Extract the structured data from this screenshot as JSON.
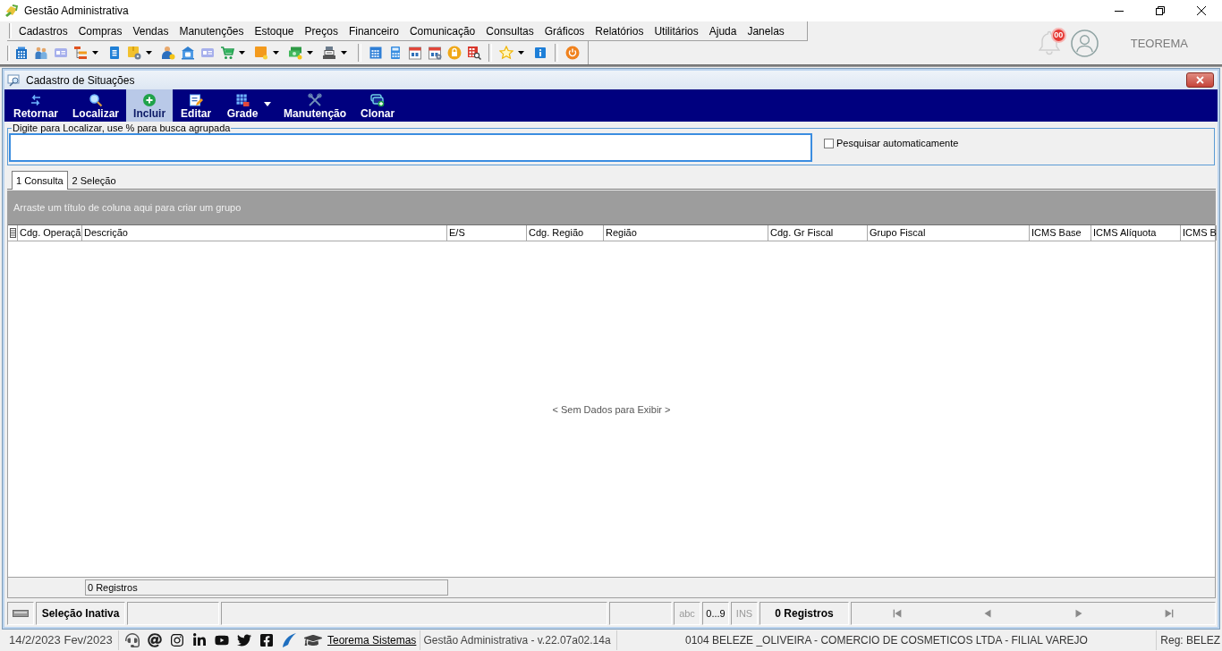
{
  "window": {
    "title": "Gestão Administrativa"
  },
  "menu": [
    {
      "label": "Cadastros"
    },
    {
      "label": "Compras"
    },
    {
      "label": "Vendas"
    },
    {
      "label": "Manutenções"
    },
    {
      "label": "Estoque"
    },
    {
      "label": "Preços"
    },
    {
      "label": "Financeiro"
    },
    {
      "label": "Comunicação"
    },
    {
      "label": "Consultas"
    },
    {
      "label": "Gráficos"
    },
    {
      "label": "Relatórios"
    },
    {
      "label": "Utilitários"
    },
    {
      "label": "Ajuda"
    },
    {
      "label": "Janelas"
    }
  ],
  "toolbar": {
    "groups": [
      {
        "items": [
          {
            "dropdown": false
          },
          {
            "dropdown": false
          },
          {
            "dropdown": false
          },
          {
            "dropdown": true
          },
          {
            "dropdown": false
          },
          {
            "dropdown": true
          },
          {
            "dropdown": false
          },
          {
            "dropdown": false
          },
          {
            "dropdown": false
          },
          {
            "dropdown": true
          },
          {
            "dropdown": true
          },
          {
            "dropdown": true
          },
          {
            "dropdown": true
          }
        ]
      },
      {
        "items": [
          {
            "dropdown": false
          },
          {
            "dropdown": false
          },
          {
            "dropdown": false
          },
          {
            "dropdown": false
          },
          {
            "dropdown": false
          },
          {
            "dropdown": false
          }
        ]
      },
      {
        "items": [
          {
            "dropdown": true
          },
          {
            "dropdown": false
          }
        ]
      },
      {
        "items": [
          {
            "dropdown": false
          }
        ]
      }
    ]
  },
  "notifications": {
    "badge": "00"
  },
  "user": {
    "name": "TEOREMA"
  },
  "form": {
    "title": "Cadastro de Situações",
    "actions": [
      {
        "label": "Retornar",
        "hovered": false,
        "dropdown": false
      },
      {
        "label": "Localizar",
        "hovered": false,
        "dropdown": false
      },
      {
        "label": "Incluir",
        "hovered": true,
        "dropdown": false
      },
      {
        "label": "Editar",
        "hovered": false,
        "dropdown": false
      },
      {
        "label": "Grade",
        "hovered": false,
        "dropdown": true
      },
      {
        "label": "Manutenção",
        "hovered": false,
        "dropdown": false
      },
      {
        "label": "Clonar",
        "hovered": false,
        "dropdown": false
      }
    ],
    "search": {
      "legend": "Digite para Localizar, use % para busca agrupada",
      "auto_search": {
        "label": "Pesquisar automaticamente",
        "checked": false
      }
    },
    "tabs": [
      {
        "label": "1 Consulta",
        "selected": true
      },
      {
        "label": "2 Seleção",
        "selected": false
      }
    ],
    "grid": {
      "group_hint": "Arraste um título de coluna aqui para criar um grupo",
      "columns": [
        "Cdg. Operaçã",
        "Descrição",
        "E/S",
        "Cdg. Região",
        "Região",
        "Cdg. Gr Fiscal",
        "Grupo Fiscal",
        "ICMS Base",
        "ICMS Alíquota",
        "ICMS B"
      ],
      "empty_text": "< Sem Dados para Exibir >",
      "footer": "0 Registros"
    },
    "status_bar": {
      "selection": "Seleção Inativa",
      "indicators": [
        {
          "label": "abc",
          "active": false
        },
        {
          "label": "0...9",
          "active": true
        },
        {
          "label": "INS",
          "active": false
        }
      ],
      "records": "0 Registros"
    }
  },
  "app_status": {
    "date": "14/2/2023 Fev/2023",
    "link": "Teorema Sistemas",
    "version": "Gestão Administrativa - v.22.07a02.14a",
    "company": "0104 BELEZE _OLIVEIRA - COMERCIO DE COSMETICOS LTDA - FILIAL VAREJO",
    "register": "Reg: BELEZ"
  }
}
